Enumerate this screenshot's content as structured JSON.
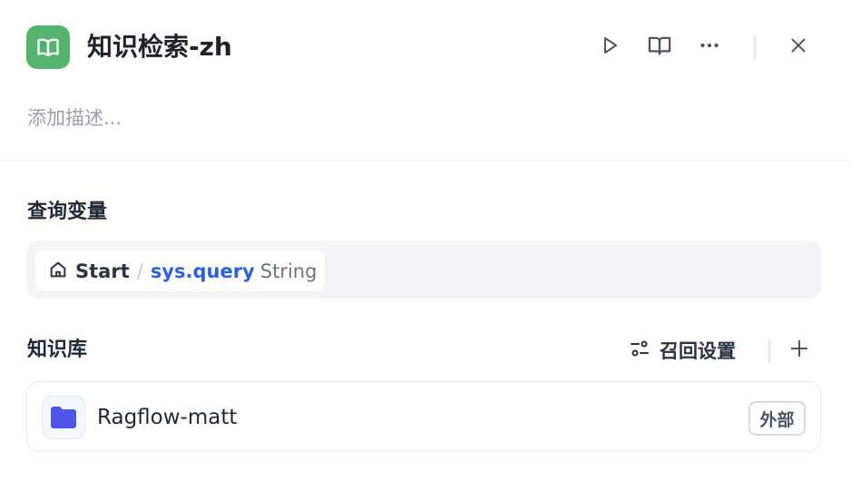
{
  "node": {
    "title": "知识检索-zh",
    "icon": "book-open-icon",
    "icon_bg": "#53b36f",
    "description_placeholder": "添加描述..."
  },
  "header_actions": [
    "play-icon",
    "book-icon",
    "more-icon",
    "close-icon"
  ],
  "query_variable": {
    "section_title": "查询变量",
    "source_node": "Start",
    "separator": "/",
    "variable_name": "sys.query",
    "variable_type": "String"
  },
  "knowledge_base": {
    "section_title": "知识库",
    "recall_settings_label": "召回设置",
    "items": [
      {
        "name": "Ragflow-matt",
        "badge": "外部",
        "icon": "folder-icon"
      }
    ]
  },
  "colors": {
    "accent_blue": "#2c5fdf",
    "folder_indigo": "#4f55e8"
  }
}
